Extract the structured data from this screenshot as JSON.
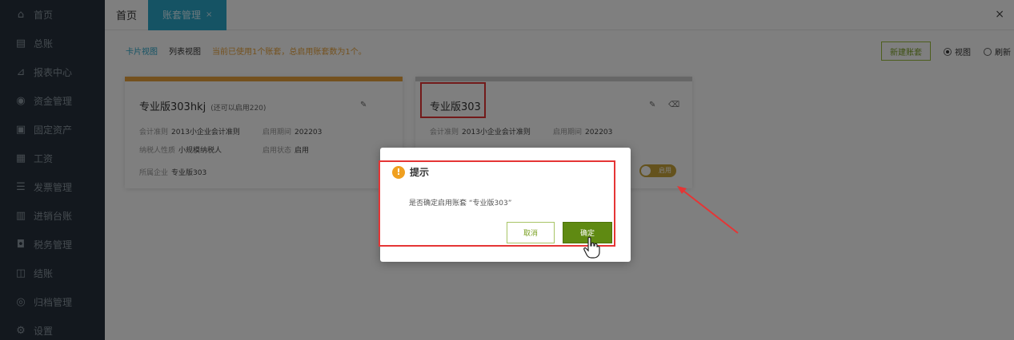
{
  "sidebar": {
    "items": [
      {
        "label": "首页",
        "icon": "home-icon"
      },
      {
        "label": "总账",
        "icon": "ledger-icon"
      },
      {
        "label": "报表中心",
        "icon": "chart-icon"
      },
      {
        "label": "资金管理",
        "icon": "money-icon"
      },
      {
        "label": "固定资产",
        "icon": "asset-icon"
      },
      {
        "label": "工资",
        "icon": "salary-icon"
      },
      {
        "label": "发票管理",
        "icon": "invoice-icon"
      },
      {
        "label": "进销台账",
        "icon": "inventory-icon"
      },
      {
        "label": "税务管理",
        "icon": "tax-icon"
      },
      {
        "label": "结账",
        "icon": "close-books-icon"
      },
      {
        "label": "归档管理",
        "icon": "archive-icon"
      },
      {
        "label": "设置",
        "icon": "settings-icon"
      }
    ]
  },
  "topbar": {
    "home_tab": "首页",
    "active_tab": "账套管理",
    "active_tab_close": "×",
    "close": "×"
  },
  "toolbar": {
    "card_view": "卡片视图",
    "list_view": "列表视图",
    "hint": "当前已使用1个账套，总启用账套数为1个。",
    "new_button": "新建账套",
    "radio_view": "视图",
    "radio_refresh": "刷新"
  },
  "cards": [
    {
      "title": "专业版303hkj",
      "subtitle": "(还可以启用220)",
      "fields": {
        "standard_label": "会计准则",
        "standard_value": "2013小企业会计准则",
        "period_label": "启用期间",
        "period_value": "202203",
        "taxpayer_label": "纳税人性质",
        "taxpayer_value": "小规模纳税人",
        "status_label": "启用状态",
        "status_value": "启用",
        "company_label": "所属企业",
        "company_value": "专业版303"
      },
      "accent": "#e8a33c"
    },
    {
      "title": "专业版303",
      "fields": {
        "standard_label": "会计准则",
        "standard_value": "2013小企业会计准则",
        "period_label": "启用期间",
        "period_value": "202203"
      },
      "toggle_label": "启用",
      "accent": "#cccccc"
    }
  ],
  "dialog": {
    "title": "提示",
    "message": "是否确定启用账套 “专业版303”",
    "cancel": "取消",
    "ok": "确定",
    "warn_glyph": "!"
  },
  "colors": {
    "sidebar_bg": "#27313c",
    "accent_teal": "#2aa6c9",
    "ok_green": "#5f8a12",
    "annotation_red": "#e53535"
  }
}
